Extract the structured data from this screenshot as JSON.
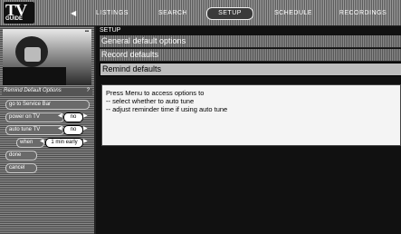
{
  "header": {
    "logo_main": "TV",
    "logo_sub": "GUIDE",
    "tabs": [
      {
        "label": "LISTINGS"
      },
      {
        "label": "SEARCH"
      },
      {
        "label": "SETUP"
      },
      {
        "label": "SCHEDULE"
      },
      {
        "label": "RECORDINGS"
      }
    ],
    "active_tab": "SETUP"
  },
  "sidebar": {
    "panel_title": "Remind Default Options",
    "go_to_service_bar": "go to Service Bar",
    "options": [
      {
        "label": "power on TV",
        "value": "no"
      },
      {
        "label": "auto tune TV",
        "value": "no"
      },
      {
        "label": "when",
        "value": "1 min early"
      }
    ],
    "done": "done",
    "cancel": "cancel"
  },
  "main": {
    "breadcrumb": "SETUP",
    "menu": [
      {
        "label": "General default options"
      },
      {
        "label": "Record defaults"
      },
      {
        "label": "Remind defaults"
      }
    ],
    "selected_index": 2,
    "info_lines": [
      "Press Menu to access options to",
      "-- select whether to auto tune",
      "-- adjust reminder time if using auto tune"
    ]
  },
  "colors": {
    "selected_row": "#bdbdbd",
    "panel_background": "#111111"
  }
}
